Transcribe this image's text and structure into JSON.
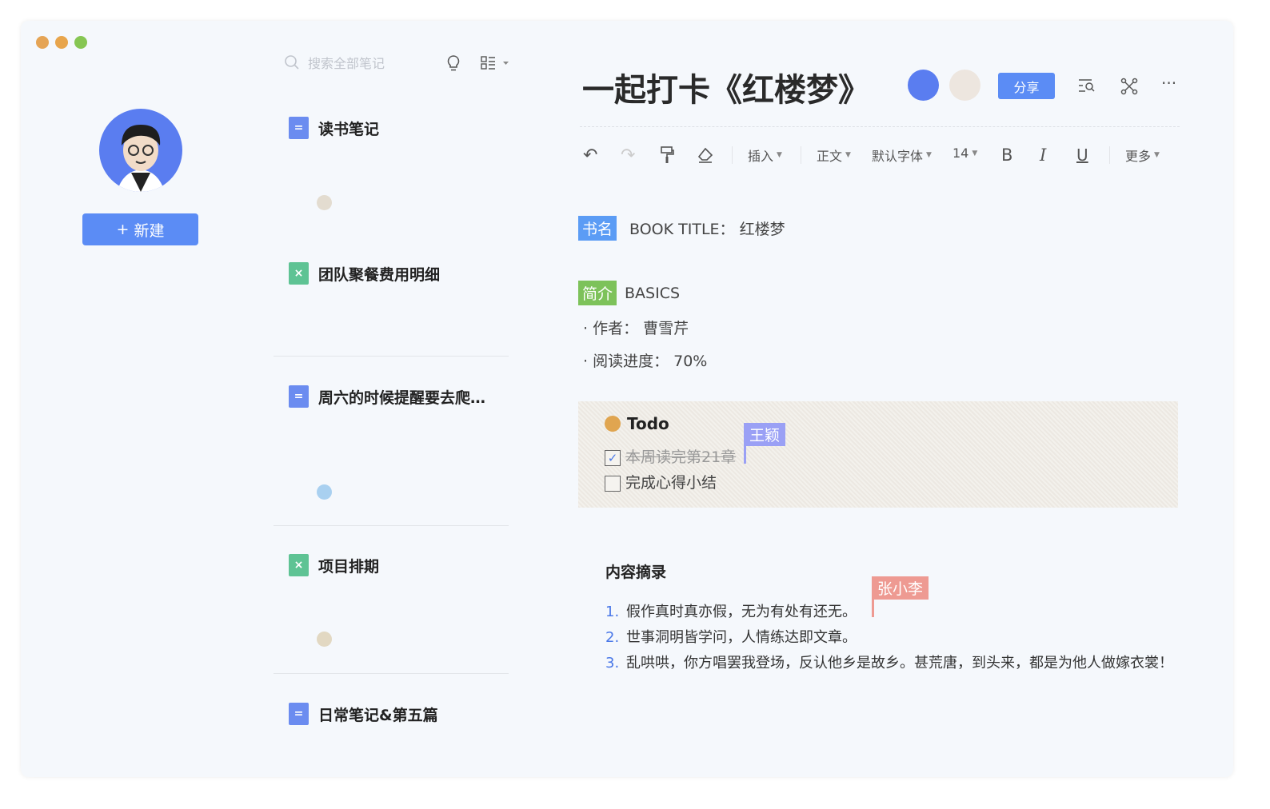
{
  "window": {
    "colors": {
      "close": "#e5a455",
      "min": "#e8a54c",
      "max": "#86c653",
      "accent": "#5b8cf5"
    }
  },
  "sidebar": {
    "new_button": "新建",
    "plus": "+"
  },
  "list": {
    "search_placeholder": "搜索全部笔记",
    "notes": [
      {
        "title": "读书笔记",
        "type": "doc"
      },
      {
        "title": "团队聚餐费用明细",
        "type": "sheet"
      },
      {
        "title": "周六的时候提醒要去爬…",
        "type": "doc"
      },
      {
        "title": "项目排期",
        "type": "sheet"
      },
      {
        "title": "日常笔记&第五篇",
        "type": "doc"
      }
    ]
  },
  "editor": {
    "title": "一起打卡《红楼梦》",
    "share": "分享",
    "more": "···",
    "toolbar": {
      "insert": "插入",
      "style": "正文",
      "font": "默认字体",
      "size": "14",
      "bold": "B",
      "italic": "I",
      "underline": "U",
      "more": "更多"
    },
    "book_tag": "书名",
    "book_line": "BOOK TITLE： 红楼梦",
    "basics_tag": "简介",
    "basics_label": "BASICS",
    "bullets": [
      "作者：  曹雪芹",
      "阅读进度：  70%"
    ],
    "todo": {
      "title": "Todo",
      "items": [
        {
          "text": "本周读完第21章",
          "done": true
        },
        {
          "text": "完成心得小结",
          "done": false
        }
      ],
      "cursor_user": "王颖"
    },
    "excerpt_title": "内容摘录",
    "excerpt_cursor_user": "张小李",
    "excerpts": [
      "假作真时真亦假，无为有处有还无。",
      "世事洞明皆学问，人情练达即文章。",
      "乱哄哄，你方唱罢我登场，反认他乡是故乡。甚荒唐，到头来，都是为他人做嫁衣裳！"
    ]
  }
}
